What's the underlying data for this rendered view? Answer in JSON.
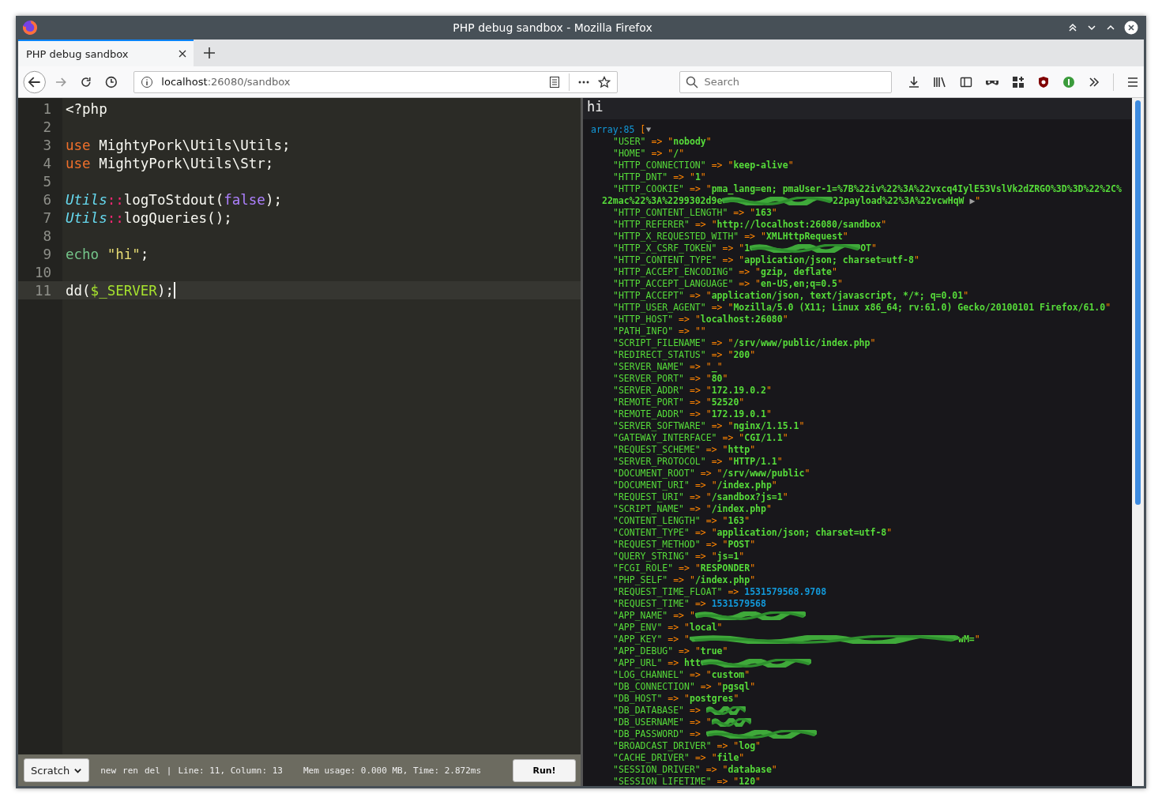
{
  "window": {
    "title": "PHP debug sandbox - Mozilla Firefox"
  },
  "tabs": [
    {
      "label": "PHP debug sandbox",
      "selected": true
    }
  ],
  "url": {
    "host": "localhost",
    "path": ":26080/sandbox"
  },
  "search": {
    "placeholder": "Search"
  },
  "editor": {
    "lines": [
      {
        "number": "1",
        "current": false,
        "cursor": false,
        "tokens": [
          {
            "kind": "plain",
            "text": "<?php"
          }
        ]
      },
      {
        "number": "2",
        "current": false,
        "cursor": false
      },
      {
        "number": "3",
        "current": false,
        "cursor": false,
        "tokens": [
          {
            "kind": "keyword",
            "text": "use"
          },
          {
            "kind": "plain",
            "text": " MightyPork\\Utils\\Utils;"
          }
        ]
      },
      {
        "number": "4",
        "current": false,
        "cursor": false,
        "tokens": [
          {
            "kind": "keyword",
            "text": "use"
          },
          {
            "kind": "plain",
            "text": " MightyPork\\Utils\\Str;"
          }
        ]
      },
      {
        "number": "5",
        "current": false,
        "cursor": false
      },
      {
        "number": "6",
        "current": false,
        "cursor": false,
        "tokens": [
          {
            "kind": "class",
            "text": "Utils"
          },
          {
            "kind": "operator",
            "text": "::"
          },
          {
            "kind": "plain",
            "text": "logToStdout("
          },
          {
            "kind": "constant",
            "text": "false"
          },
          {
            "kind": "plain",
            "text": ");"
          }
        ]
      },
      {
        "number": "7",
        "current": false,
        "cursor": false,
        "tokens": [
          {
            "kind": "class",
            "text": "Utils"
          },
          {
            "kind": "operator",
            "text": "::"
          },
          {
            "kind": "plain",
            "text": "logQueries();"
          }
        ]
      },
      {
        "number": "8",
        "current": false,
        "cursor": false
      },
      {
        "number": "9",
        "current": false,
        "cursor": false,
        "tokens": [
          {
            "kind": "builtin",
            "text": "echo"
          },
          {
            "kind": "string",
            "text": " \"hi\""
          },
          {
            "kind": "plain",
            "text": ";"
          }
        ]
      },
      {
        "number": "10",
        "current": false,
        "cursor": false
      },
      {
        "number": "11",
        "current": true,
        "cursor": true,
        "tokens": [
          {
            "kind": "plain",
            "text": "dd("
          },
          {
            "kind": "variable",
            "text": "$_SERVER"
          },
          {
            "kind": "plain",
            "text": ");"
          }
        ]
      }
    ]
  },
  "footer": {
    "file_select": "Scratch",
    "actions": [
      "new",
      "ren",
      "del"
    ],
    "separator": "|",
    "position": "Line: 11, Column: 13",
    "stats": "Mem usage: 0.000 MB, Time: 2.872ms",
    "run_button": "Run!"
  },
  "output": {
    "echo": "hi",
    "dump": {
      "header": "array:85",
      "open": "[",
      "arrow": "=>",
      "expanded": true,
      "entries": [
        {
          "key": "\"USER\"",
          "kind": "string",
          "value": "\"nobody\""
        },
        {
          "key": "\"HOME\"",
          "kind": "string",
          "value": "\"/\""
        },
        {
          "key": "\"HTTP_CONNECTION\"",
          "kind": "string",
          "value": "\"keep-alive\""
        },
        {
          "key": "\"HTTP_DNT\"",
          "kind": "string",
          "value": "\"1\""
        },
        {
          "key": "\"HTTP_COOKIE\"",
          "kind": "parts",
          "parts": [
            {
              "kind": "quote",
              "text": "\""
            },
            {
              "kind": "string",
              "text": "pma_lang=en; pmaUser-1=%7B%22iv%22%3A%22vxcq4IylE53VslVk2dZRGO%3D%3D%22%2C%22mac%22%3A%2299302d9e"
            },
            {
              "kind": "redaction"
            },
            {
              "kind": "string",
              "text": "22payload%22%3A%22vcwHqW"
            },
            {
              "kind": "toggle",
              "text": " ▶"
            },
            {
              "kind": "quote",
              "text": "\""
            }
          ]
        },
        {
          "key": "\"HTTP_CONTENT_LENGTH\"",
          "kind": "string",
          "value": "\"163\""
        },
        {
          "key": "\"HTTP_REFERER\"",
          "kind": "string",
          "value": "\"http://localhost:26080/sandbox\""
        },
        {
          "key": "\"HTTP_X_REQUESTED_WITH\"",
          "kind": "string",
          "value": "\"XMLHttpRequest\""
        },
        {
          "key": "\"HTTP_X_CSRF_TOKEN\"",
          "kind": "parts",
          "parts": [
            {
              "kind": "quote",
              "text": "\""
            },
            {
              "kind": "string",
              "text": "1"
            },
            {
              "kind": "redaction"
            },
            {
              "kind": "string",
              "text": "OT"
            },
            {
              "kind": "quote",
              "text": "\""
            }
          ]
        },
        {
          "key": "\"HTTP_CONTENT_TYPE\"",
          "kind": "string",
          "value": "\"application/json; charset=utf-8\""
        },
        {
          "key": "\"HTTP_ACCEPT_ENCODING\"",
          "kind": "string",
          "value": "\"gzip, deflate\""
        },
        {
          "key": "\"HTTP_ACCEPT_LANGUAGE\"",
          "kind": "string",
          "value": "\"en-US,en;q=0.5\""
        },
        {
          "key": "\"HTTP_ACCEPT\"",
          "kind": "string",
          "value": "\"application/json, text/javascript, */*; q=0.01\""
        },
        {
          "key": "\"HTTP_USER_AGENT\"",
          "kind": "string",
          "value": "\"Mozilla/5.0 (X11; Linux x86_64; rv:61.0) Gecko/20100101 Firefox/61.0\""
        },
        {
          "key": "\"HTTP_HOST\"",
          "kind": "string",
          "value": "\"localhost:26080\""
        },
        {
          "key": "\"PATH_INFO\"",
          "kind": "string",
          "value": "\"\""
        },
        {
          "key": "\"SCRIPT_FILENAME\"",
          "kind": "string",
          "value": "\"/srv/www/public/index.php\""
        },
        {
          "key": "\"REDIRECT_STATUS\"",
          "kind": "string",
          "value": "\"200\""
        },
        {
          "key": "\"SERVER_NAME\"",
          "kind": "string",
          "value": "\"_\""
        },
        {
          "key": "\"SERVER_PORT\"",
          "kind": "string",
          "value": "\"80\""
        },
        {
          "key": "\"SERVER_ADDR\"",
          "kind": "string",
          "value": "\"172.19.0.2\""
        },
        {
          "key": "\"REMOTE_PORT\"",
          "kind": "string",
          "value": "\"52520\""
        },
        {
          "key": "\"REMOTE_ADDR\"",
          "kind": "string",
          "value": "\"172.19.0.1\""
        },
        {
          "key": "\"SERVER_SOFTWARE\"",
          "kind": "string",
          "value": "\"nginx/1.15.1\""
        },
        {
          "key": "\"GATEWAY_INTERFACE\"",
          "kind": "string",
          "value": "\"CGI/1.1\""
        },
        {
          "key": "\"REQUEST_SCHEME\"",
          "kind": "string",
          "value": "\"http\""
        },
        {
          "key": "\"SERVER_PROTOCOL\"",
          "kind": "string",
          "value": "\"HTTP/1.1\""
        },
        {
          "key": "\"DOCUMENT_ROOT\"",
          "kind": "string",
          "value": "\"/srv/www/public\""
        },
        {
          "key": "\"DOCUMENT_URI\"",
          "kind": "string",
          "value": "\"/index.php\""
        },
        {
          "key": "\"REQUEST_URI\"",
          "kind": "string",
          "value": "\"/sandbox?js=1\""
        },
        {
          "key": "\"SCRIPT_NAME\"",
          "kind": "string",
          "value": "\"/index.php\""
        },
        {
          "key": "\"CONTENT_LENGTH\"",
          "kind": "string",
          "value": "\"163\""
        },
        {
          "key": "\"CONTENT_TYPE\"",
          "kind": "string",
          "value": "\"application/json; charset=utf-8\""
        },
        {
          "key": "\"REQUEST_METHOD\"",
          "kind": "string",
          "value": "\"POST\""
        },
        {
          "key": "\"QUERY_STRING\"",
          "kind": "string",
          "value": "\"js=1\""
        },
        {
          "key": "\"FCGI_ROLE\"",
          "kind": "string",
          "value": "\"RESPONDER\""
        },
        {
          "key": "\"PHP_SELF\"",
          "kind": "string",
          "value": "\"/index.php\""
        },
        {
          "key": "\"REQUEST_TIME_FLOAT\"",
          "kind": "number",
          "value": "1531579568.9708"
        },
        {
          "key": "\"REQUEST_TIME\"",
          "kind": "number",
          "value": "1531579568"
        },
        {
          "key": "\"APP_NAME\"",
          "kind": "parts",
          "parts": [
            {
              "kind": "quote",
              "text": "\""
            },
            {
              "kind": "redaction"
            }
          ]
        },
        {
          "key": "\"APP_ENV\"",
          "kind": "string",
          "value": "\"local\""
        },
        {
          "key": "\"APP_KEY\"",
          "kind": "parts",
          "parts": [
            {
              "kind": "quote",
              "text": "\""
            },
            {
              "kind": "redaction",
              "long": true
            },
            {
              "kind": "string",
              "text": "wM="
            },
            {
              "kind": "quote",
              "text": "\""
            }
          ]
        },
        {
          "key": "\"APP_DEBUG\"",
          "kind": "string",
          "value": "\"true\""
        },
        {
          "key": "\"APP_URL\"",
          "kind": "parts",
          "parts": [
            {
              "kind": "string",
              "text": "htt"
            },
            {
              "kind": "redaction"
            }
          ]
        },
        {
          "key": "\"LOG_CHANNEL\"",
          "kind": "string",
          "value": "\"custom\""
        },
        {
          "key": "\"DB_CONNECTION\"",
          "kind": "string",
          "value": "\"pgsql\""
        },
        {
          "key": "\"DB_HOST\"",
          "kind": "string",
          "value": "\"postgres\""
        },
        {
          "key": "\"DB_DATABASE\"",
          "kind": "parts",
          "parts": [
            {
              "kind": "redaction",
              "short": true
            }
          ]
        },
        {
          "key": "\"DB_USERNAME\"",
          "kind": "parts",
          "parts": [
            {
              "kind": "quote",
              "text": "\""
            },
            {
              "kind": "redaction",
              "short": true
            }
          ]
        },
        {
          "key": "\"DB_PASSWORD\"",
          "kind": "parts",
          "parts": [
            {
              "kind": "redaction"
            }
          ]
        },
        {
          "key": "\"BROADCAST_DRIVER\"",
          "kind": "string",
          "value": "\"log\""
        },
        {
          "key": "\"CACHE_DRIVER\"",
          "kind": "string",
          "value": "\"file\""
        },
        {
          "key": "\"SESSION_DRIVER\"",
          "kind": "string",
          "value": "\"database\""
        },
        {
          "key": "\"SESSION_LIFETIME\"",
          "kind": "string",
          "value": "\"120\""
        }
      ]
    }
  }
}
